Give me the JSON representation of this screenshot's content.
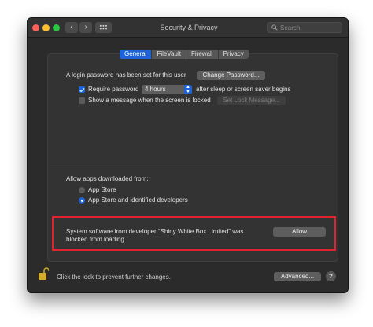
{
  "window": {
    "title": "Security & Privacy",
    "search_placeholder": "Search",
    "back_glyph": "‹",
    "forward_glyph": "›"
  },
  "tabs": [
    {
      "label": "General",
      "active": true
    },
    {
      "label": "FileVault",
      "active": false
    },
    {
      "label": "Firewall",
      "active": false
    },
    {
      "label": "Privacy",
      "active": false
    }
  ],
  "general": {
    "login_password_text": "A login password has been set for this user",
    "change_password_label": "Change Password...",
    "require_password_label": "Require password",
    "require_password_checked": true,
    "require_password_delay": "4 hours",
    "require_password_suffix": "after sleep or screen saver begins",
    "show_message_label": "Show a message when the screen is locked",
    "show_message_checked": false,
    "set_lock_message_label": "Set Lock Message..."
  },
  "allow_apps": {
    "heading": "Allow apps downloaded from:",
    "options": [
      {
        "label": "App Store",
        "selected": false
      },
      {
        "label": "App Store and identified developers",
        "selected": true
      }
    ]
  },
  "blocked": {
    "line1": "System software from developer “Shiny White Box Limited” was",
    "line2": "blocked from loading.",
    "allow_label": "Allow"
  },
  "footer": {
    "lock_text": "Click the lock to prevent further changes.",
    "advanced_label": "Advanced...",
    "help_label": "?"
  },
  "colors": {
    "accent": "#1d64d9",
    "highlight_box": "#e0232e",
    "window_bg": "#2b2b2b"
  },
  "icons": [
    "search-icon",
    "grid-icon",
    "lock-icon",
    "help-icon"
  ]
}
